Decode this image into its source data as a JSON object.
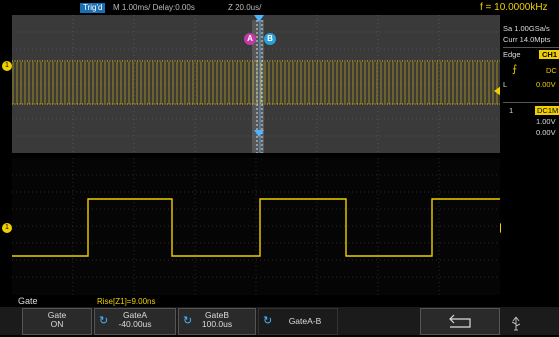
{
  "header": {
    "trigger_status": "Trig'd",
    "timebase": "M 1.00ms/ Delay:0.00s",
    "zoom": "Z 20.0us/",
    "frequency": "f = 10.0000kHz"
  },
  "side_panel": {
    "sample_rate": "Sa 1.00GSa/s",
    "memory_depth": "Curr 14.0Mpts",
    "trigger_type": "Edge",
    "trigger_source": "CH1",
    "slope_icon": "rising-edge-icon",
    "coupling": "DC",
    "level_label": "L",
    "level_value": "0.00V",
    "channel_number": "1",
    "channel_coupling": "DC1M",
    "channel_scale": "1.00V",
    "channel_offset": "0.00V"
  },
  "markers": {
    "a": "A",
    "b": "B"
  },
  "measurement": {
    "menu_title": "Gate",
    "rise_readout": "Rise[Z1]=9.00ns"
  },
  "softkeys": [
    {
      "line1": "Gate",
      "line2": "ON"
    },
    {
      "line1": "GateA",
      "line2": "-40.00us"
    },
    {
      "line1": "GateB",
      "line2": "100.0us"
    },
    {
      "line1": "GateA-B",
      "line2": ""
    },
    {
      "line1": "",
      "line2": ""
    }
  ],
  "colors": {
    "channel1": "#f0d000",
    "accent_blue": "#1a6fb3",
    "marker_a": "#c23aa8",
    "marker_b": "#2aa0d8"
  }
}
